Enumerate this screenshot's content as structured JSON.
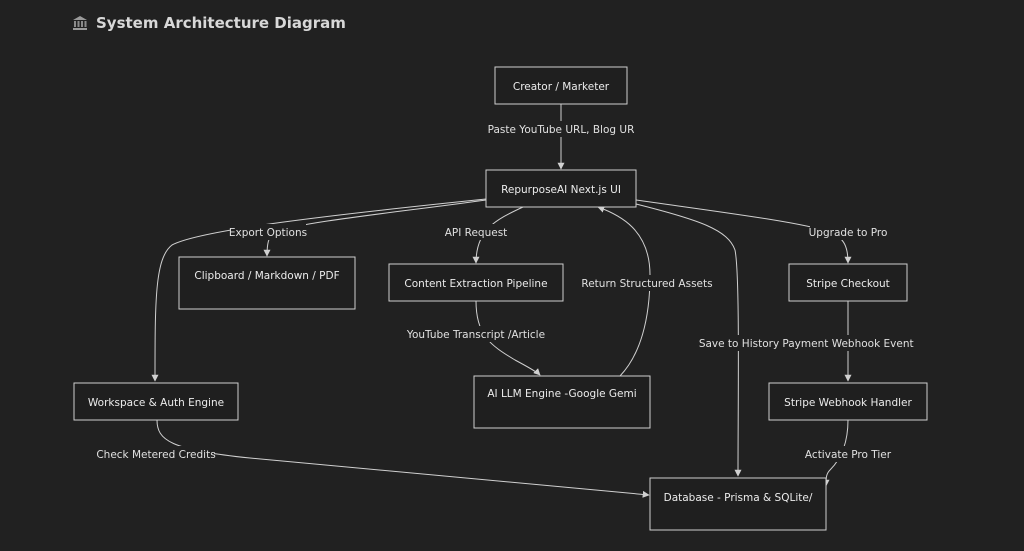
{
  "header": {
    "icon": "building-icon",
    "title": "System Architecture Diagram"
  },
  "nodes": {
    "creator": "Creator / Marketer",
    "ui": "RepurposeAI Next.js UI",
    "clipboard": "Clipboard / Markdown / PDF",
    "extraction": "Content Extraction Pipeline",
    "stripe_checkout": "Stripe Checkout",
    "workspace": "Workspace & Auth Engine",
    "llm": "AI LLM Engine -Google Gemi",
    "stripe_webhook": "Stripe Webhook Handler",
    "database": "Database - Prisma & SQLite/"
  },
  "edges": {
    "paste": "Paste YouTube URL, Blog UR",
    "export": "Export Options",
    "api": "API Request",
    "upgrade": "Upgrade to Pro",
    "return_assets": "Return Structured Assets",
    "transcript": "YouTube Transcript /Article",
    "save_history": "Save to History",
    "payment_event": "Payment Webhook Event",
    "check_credits": "Check Metered Credits",
    "activate_pro": "Activate Pro Tier"
  }
}
